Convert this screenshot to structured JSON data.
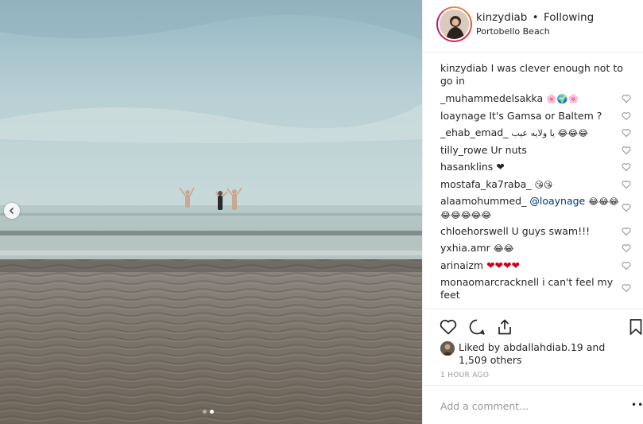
{
  "post": {
    "photo": {
      "description": "Three people in swimsuits wading in the sea at a sandy beach under an overcast sky"
    },
    "carousel": {
      "dots": 2,
      "active": 2
    }
  },
  "header": {
    "username": "kinzydiab",
    "separator": "•",
    "follow_label": "Following",
    "location": "Portobello Beach"
  },
  "caption": {
    "username": "kinzydiab",
    "text": "I was clever enough not to go in"
  },
  "comments": [
    {
      "username": "_muhammedelsakka",
      "text": "🌸🌍🌸"
    },
    {
      "username": "loaynage",
      "text": "It's Gamsa or Baltem ?"
    },
    {
      "username": "_ehab_emad_",
      "text": "يا ولايه عيب 😂😂😂"
    },
    {
      "username": "tilly_rowe",
      "text": "Ur nuts"
    },
    {
      "username": "hasanklins",
      "text": "❤"
    },
    {
      "username": "mostafa_ka7raba_",
      "text": "😘😘"
    },
    {
      "username": "alaamohummed_",
      "mention": "@loaynage",
      "text": "😂😂😂😂😂😂😂😂"
    },
    {
      "username": "chloehorswell",
      "text": "U guys swam!!!"
    },
    {
      "username": "yxhia.amr",
      "text": "😂😂"
    },
    {
      "username": "arinaizm",
      "text": "❤❤❤❤"
    },
    {
      "username": "monaomarcracknell",
      "text": "i can't feel my feet"
    }
  ],
  "likes": {
    "prefix": "Liked by",
    "by_user": "abdallahdiab.19",
    "and_label": "and",
    "others": "1,509 others"
  },
  "timestamp": "1 HOUR AGO",
  "add_comment": {
    "placeholder": "Add a comment...",
    "more_label": "•••"
  },
  "colors": {
    "link": "#003569",
    "text": "#262626",
    "muted": "#999999",
    "border": "#efefef"
  }
}
